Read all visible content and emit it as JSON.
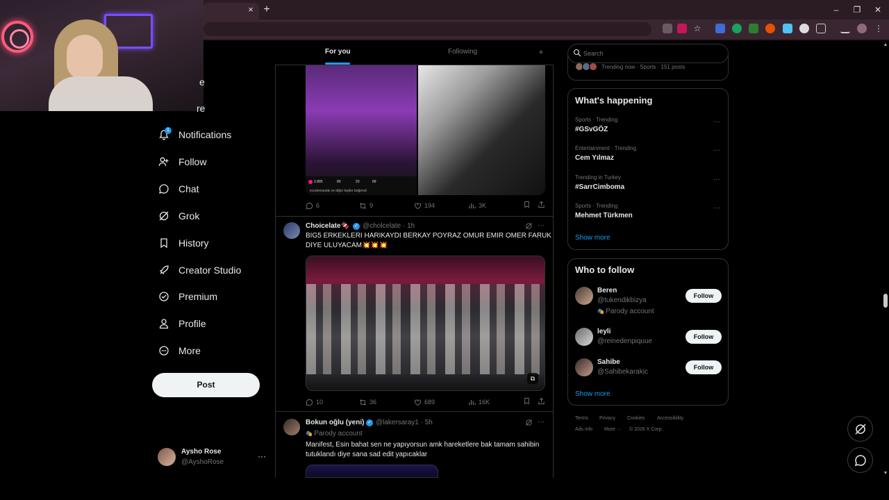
{
  "browser": {
    "tab_close": "×",
    "tab_new": "+",
    "minimize": "–",
    "maximize": "❐",
    "close": "✕"
  },
  "nav": {
    "partial_label": "re",
    "partial_label2": "e",
    "notifications_count": "1",
    "items": [
      {
        "label": "Notifications"
      },
      {
        "label": "Follow"
      },
      {
        "label": "Chat"
      },
      {
        "label": "Grok"
      },
      {
        "label": "History"
      },
      {
        "label": "Creator Studio"
      },
      {
        "label": "Premium"
      },
      {
        "label": "Profile"
      },
      {
        "label": "More"
      }
    ],
    "post_button": "Post",
    "account": {
      "name": "Aysho Rose",
      "handle": "@AyshoRose",
      "more": "···"
    }
  },
  "timeline": {
    "tabs": {
      "for_you": "For you",
      "following": "Following",
      "plus": "+"
    },
    "tweet1": {
      "mini_stats": [
        "2.885",
        "80",
        "20",
        "89"
      ],
      "mini_caption": "ecodenseails ve diğer kişiler beğendi",
      "replies": "6",
      "reposts": "9",
      "likes": "194",
      "views": "3K"
    },
    "tweet2": {
      "name": "Choicelate",
      "name_emoji": "🍫",
      "handle_time": "@cholcelate · 1h",
      "text_line1": "BIG5 ERKEKLERI HARIKAYDI BERKAY POYRAZ OMUR EMIR OMER FARUK",
      "text_line2": "DIYE ULUYACAM💥💥💥",
      "replies": "10",
      "reposts": "36",
      "likes": "689",
      "views": "16K"
    },
    "tweet3": {
      "name": "Bokun oğlu (yeni)",
      "handle_time": "@lakersaray1 · 5h",
      "parody": "Parody account",
      "text_line1": "Manifest, Esin bahat sen ne yapıyorsun amk hareketlere bak tamam sahibin",
      "text_line2": "tutuklandı diye sana sad edit yapıcaklar"
    }
  },
  "sidebar": {
    "search_placeholder": "Search",
    "trending_top": "Trending now · Sports · 151 posts",
    "whats_happening": {
      "title": "What's happening",
      "trends": [
        {
          "meta": "Sports · Trending",
          "name": "#GSvGÖZ"
        },
        {
          "meta": "Entertainment · Trending",
          "name": "Cem Yılmaz"
        },
        {
          "meta": "Trending in Turkey",
          "name": "#SarrCimboma"
        },
        {
          "meta": "Sports · Trending",
          "name": "Mehmet Türkmen"
        }
      ],
      "show_more": "Show more"
    },
    "who_to_follow": {
      "title": "Who to follow",
      "users": [
        {
          "name": "Beren",
          "handle": "@tukendikbizya",
          "parody": "Parody account",
          "button": "Follow"
        },
        {
          "name": "leyli",
          "handle": "@reinedenpiquue",
          "button": "Follow"
        },
        {
          "name": "Sahibe",
          "handle": "@Sahibekarakic",
          "button": "Follow"
        }
      ],
      "show_more": "Show more"
    },
    "footer": {
      "row1": [
        "Terms",
        "Privacy",
        "Cookies",
        "Accessibility"
      ],
      "row2": [
        "Ads info",
        "More ···",
        "© 2026 X Corp."
      ]
    }
  },
  "colors": {
    "accent": "#1d9bf0",
    "background": "#000000",
    "text": "#e7e9ea",
    "muted": "#71767b",
    "border": "#2f3336"
  }
}
